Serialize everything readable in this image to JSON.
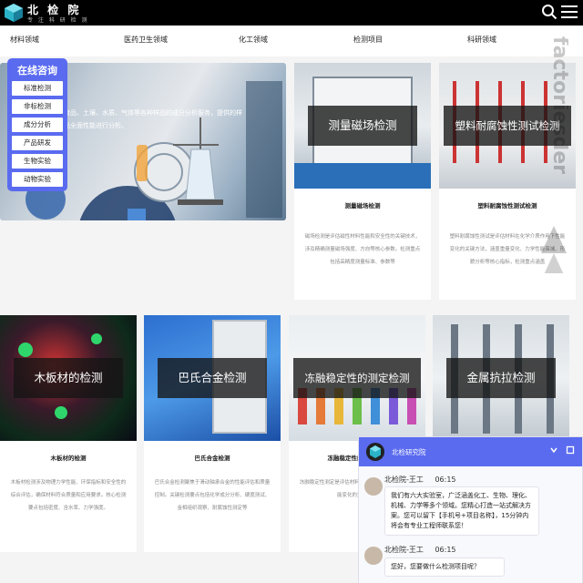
{
  "header": {
    "logo_title": "北 检 院",
    "logo_subtitle": "专 注 科 研 检 测",
    "icons": {
      "logo": "cube-logo-icon",
      "search": "search-icon",
      "menu": "hamburger-menu-icon"
    }
  },
  "nav": {
    "items": [
      "材料领域",
      "医药卫生领域",
      "化工领域",
      "检测项目",
      "科研领域"
    ]
  },
  "watermark": {
    "text": "factoriesder"
  },
  "hero": {
    "text_line1": "食品、土壤、水质、气体等各种样品的成分分析服务，提供的样",
    "text_line2": "品全面性能进行分析。"
  },
  "consult": {
    "title": "在线咨询",
    "buttons": [
      "标准检测",
      "非标检测",
      "成分分析",
      "产品研发",
      "生物实验",
      "动物实验"
    ]
  },
  "cards": [
    {
      "overlay": "测量磁场检测",
      "title": "测量磁场检测",
      "desc": "磁场检测是评估磁性材料性能和安全性的关键技术，涉及精确测量磁场强度、方向等核心参数。检测重点包括高精度测量标准、参数等"
    },
    {
      "overlay": "塑料耐腐蚀性测试检测",
      "title": "塑料耐腐蚀性测试检测",
      "desc": "塑料耐腐蚀性测试是评估材料在化学介质作用下性能变化的关键方法，涵盖重量变化、力学性能衰减、形貌分析等核心指标，检测重点涵盖"
    },
    {
      "overlay": "木板材的检测",
      "title": "木板材的检测",
      "desc": "木板材检测涉及物理力学性能、环保指标和安全性的综合评估，确保材料符合质量和应用要求。核心检测要点包括密度、含水率、力学强度。"
    },
    {
      "overlay": "巴氏合金检测",
      "title": "巴氏合金检测",
      "desc": "巴氏合金检测聚焦于滑动轴承合金的性能评估和质量控制。关键检测要点包括化学成分分析、硬度测试、金相组织观察、耐腐蚀性测定等"
    },
    {
      "overlay": "冻融稳定性的测定检测",
      "title": "冻融稳定性的测定检测",
      "desc": "冻融稳定性测定是评估材料在反复冻融循环条件下性能变化的重要方法"
    },
    {
      "overlay": "金属抗拉检测",
      "title": "",
      "desc": ""
    }
  ],
  "chat": {
    "header_title": "北检研究院",
    "messages": [
      {
        "name": "北检院-王工",
        "time": "06:15",
        "text": "我们有六大实验室，广泛涵盖化工、生物、理化、机械、力学等多个领域。您精心打造一站式解决方案。您可以留下【手机号+项目名称】，15分钟内将会有专业工程师联系您！"
      },
      {
        "name": "北检院-王工",
        "time": "06:15",
        "text": "您好，您要做什么检测项目呢？"
      }
    ]
  }
}
